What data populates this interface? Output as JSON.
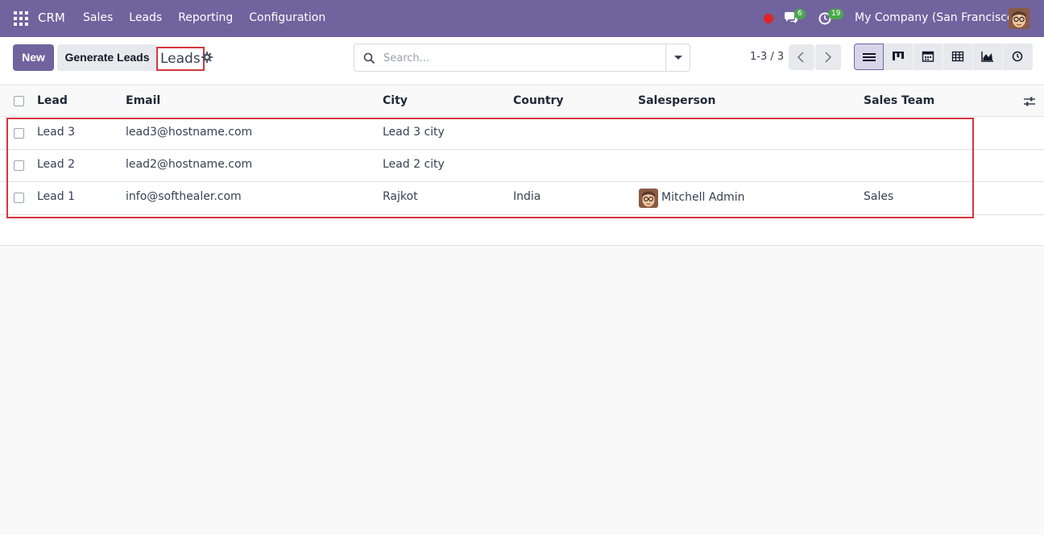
{
  "navbar": {
    "brand": "CRM",
    "menu": [
      "Sales",
      "Leads",
      "Reporting",
      "Configuration"
    ],
    "messages_count": "6",
    "activities_count": "19",
    "company": "My Company (San Francisco)"
  },
  "control": {
    "new_label": "New",
    "generate_label": "Generate Leads",
    "breadcrumb": "Leads",
    "search_placeholder": "Search...",
    "pager": "1-3 / 3"
  },
  "table": {
    "columns": [
      "Lead",
      "Email",
      "City",
      "Country",
      "Salesperson",
      "Sales Team"
    ],
    "rows": [
      {
        "lead": "Lead 3",
        "email": "lead3@hostname.com",
        "city": "Lead 3 city",
        "country": "",
        "salesperson": "",
        "team": ""
      },
      {
        "lead": "Lead 2",
        "email": "lead2@hostname.com",
        "city": "Lead 2 city",
        "country": "",
        "salesperson": "",
        "team": ""
      },
      {
        "lead": "Lead 1",
        "email": "info@softhealer.com",
        "city": "Rajkot",
        "country": "India",
        "salesperson": "Mitchell Admin",
        "team": "Sales"
      }
    ]
  },
  "colors": {
    "brand": "#71639e",
    "highlight": "#d4373c",
    "badge": "#4ca74c",
    "record_dot": "#e02424"
  },
  "icons": [
    "apps-icon",
    "chat-icon",
    "clock-icon",
    "gear-icon",
    "search-icon",
    "caret-down-icon",
    "chevron-left-icon",
    "chevron-right-icon",
    "list-view-icon",
    "kanban-view-icon",
    "calendar-view-icon",
    "pivot-view-icon",
    "graph-view-icon",
    "activity-view-icon",
    "optional-columns-icon"
  ]
}
